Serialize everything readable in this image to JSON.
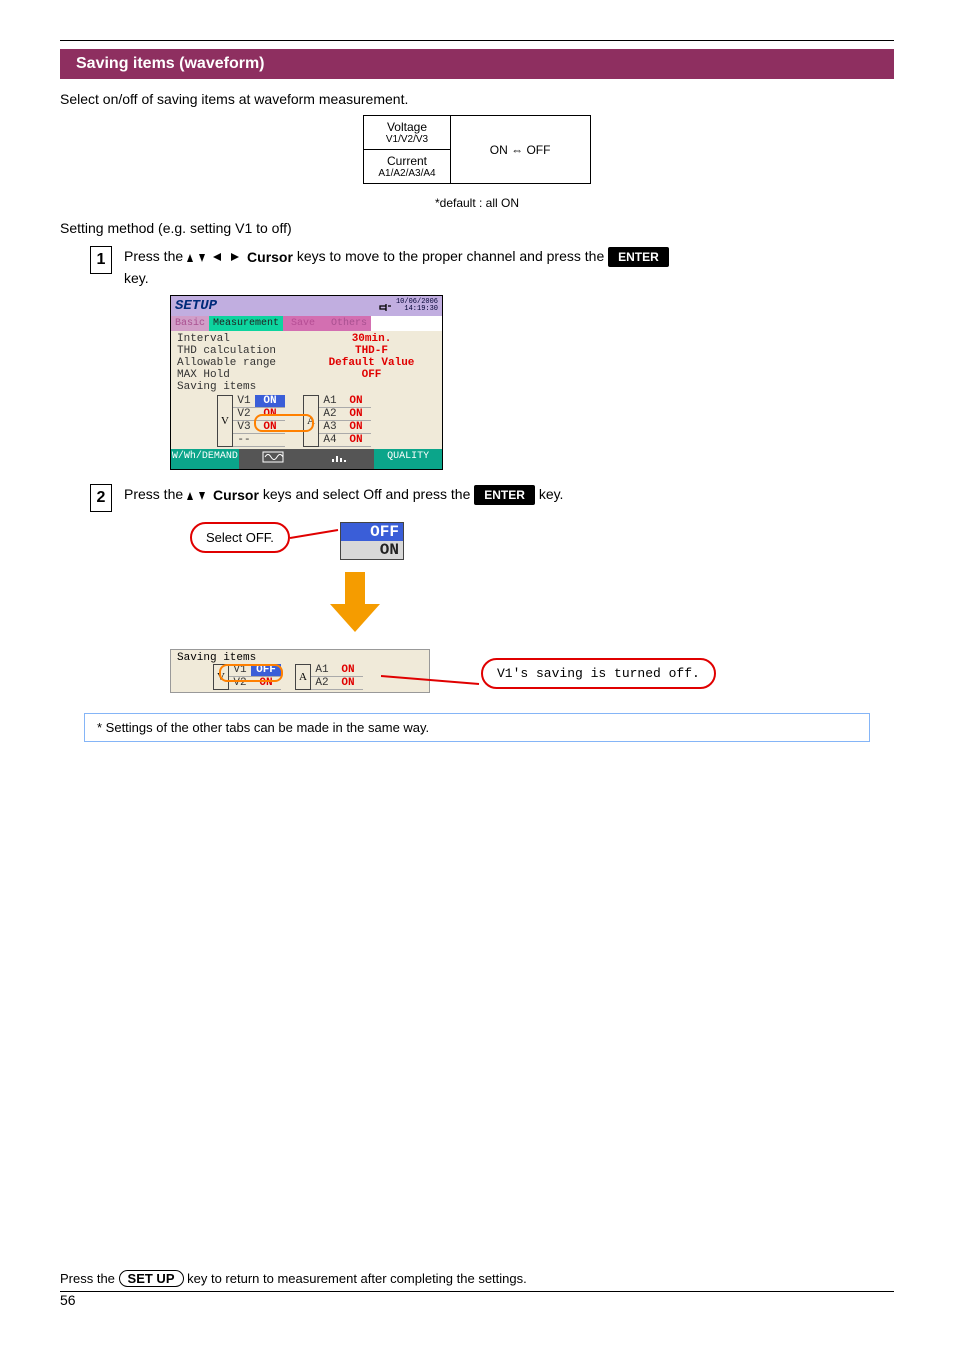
{
  "section_title": "Saving items (waveform)",
  "intro": "Select on/off of saving items at waveform measurement.",
  "spec": {
    "voltage_label": "Voltage",
    "voltage_range": "V1/V2/V3",
    "current_label": "Current",
    "current_range": "A1/A2/A3/A4",
    "value_arrow": "ON ⇔ OFF"
  },
  "default_note": "*default : all ON",
  "method_label": "Setting method (e.g. setting V1 to off)",
  "steps": {
    "s1_text_a": "Press the ",
    "s1_text_b": " keys to move to the proper channel and press the ",
    "s1_btn_enter": "ENTER",
    "s1_text_c": "key.",
    "s2_text_a": "Press the ",
    "s2_text_b": " keys and select Off and press the ",
    "s2_btn_enter": "ENTER",
    "s2_text_c": " key."
  },
  "step_numbers": {
    "one": "1",
    "two": "2"
  },
  "cursor_word": "Cursor",
  "device": {
    "title": "SETUP",
    "date": "10/06/2006",
    "time": "14:19:30",
    "tabs": {
      "basic": "Basic",
      "measurement": "Measurement",
      "save": "Save",
      "others": "Others"
    },
    "rows": {
      "interval_l": "Interval",
      "interval_v": "30min.",
      "thd_l": "THD calculation",
      "thd_v": "THD-F",
      "allow_l": "Allowable range",
      "allow_v": "Default Value",
      "max_l": "MAX Hold",
      "max_v": "OFF",
      "saving_l": "Saving items"
    },
    "v_label": "V",
    "a_label": "A",
    "v_items": [
      {
        "id": "V1",
        "state": "ON",
        "blue": true
      },
      {
        "id": "V2",
        "state": "ON"
      },
      {
        "id": "V3",
        "state": "ON"
      },
      {
        "id": "--",
        "state": ""
      }
    ],
    "a_items": [
      {
        "id": "A1",
        "state": "ON"
      },
      {
        "id": "A2",
        "state": "ON"
      },
      {
        "id": "A3",
        "state": "ON"
      },
      {
        "id": "A4",
        "state": "ON"
      }
    ],
    "footer": {
      "f1": "W/Wh/DEMAND",
      "f2": "",
      "f3": "",
      "f4": "QUALITY"
    }
  },
  "bubble1": "Select OFF.",
  "popup": {
    "off": "OFF",
    "on": "ON"
  },
  "result": {
    "saving_l": "Saving items",
    "v1_id": "V1",
    "v1_state": "OFF",
    "v2_id": "V2",
    "v2_state": "ON",
    "a1_id": "A1",
    "a1_state": "ON",
    "a2_id": "A2",
    "a2_state": "ON"
  },
  "bubble2": "V1's saving is turned off.",
  "note_box": "*  Settings of the other tabs can be made in the same way.",
  "bottom": {
    "text_a": "Press the ",
    "btn": "SET UP",
    "text_b": " key to return to measurement after completing the settings."
  },
  "page_number": "56"
}
